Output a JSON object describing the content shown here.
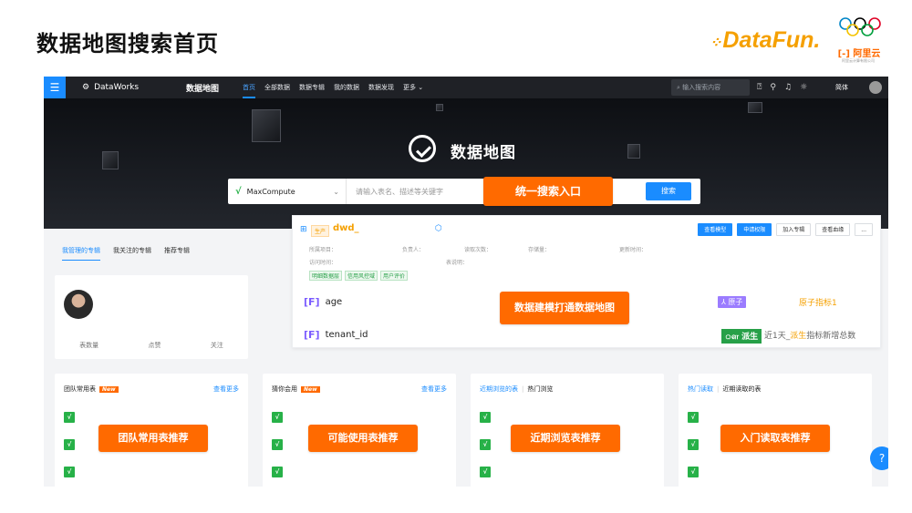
{
  "slide": {
    "title": "数据地图搜索首页"
  },
  "logos": {
    "datafun": "DataFun.",
    "aliyun": "阿里云",
    "aliyun_sub": "阿里云计算有限公司"
  },
  "colors": {
    "accent": "#1a8cff",
    "callout": "#ff6a00",
    "topbar": "#1f2126",
    "green": "#27b148"
  },
  "topbar": {
    "brand": "DataWorks",
    "product": "数据地图",
    "nav": [
      "首页",
      "全部数据",
      "数据专辑",
      "我的数据",
      "数据发现",
      "更多 ⌄"
    ],
    "search_placeholder": "输入搜索内容",
    "lang": "简体",
    "icons": [
      "help-icon",
      "wrench-icon",
      "bell-icon",
      "bug-icon"
    ]
  },
  "hero": {
    "title": "数据地图",
    "engine": "MaxCompute",
    "placeholder": "请输入表名、描述等关键字",
    "search_button": "搜索",
    "callout": "统一搜索入口"
  },
  "tabs": [
    "我管理的专辑",
    "我关注的专辑",
    "推荐专辑"
  ],
  "profile": {
    "stats": [
      "表数量",
      "点赞",
      "关注"
    ]
  },
  "result": {
    "env": "生产",
    "name": "dwd_",
    "buttons": [
      "查看模型",
      "申请权限",
      "加入专辑",
      "查看血缘",
      "..."
    ],
    "meta_row1": [
      "所属项目：",
      "负责人：",
      "读取次数：",
      "存储量：",
      "更新时间："
    ],
    "meta_row2": [
      "访问时间：",
      "表说明："
    ],
    "tags": [
      "明细数据层",
      "信用风控域",
      "用户评价"
    ],
    "fields": [
      {
        "icon": "[F]",
        "name": "age"
      },
      {
        "icon": "[F]",
        "name": "tenant_id"
      }
    ],
    "atom_badge": "⅄ 原子",
    "atom_text": "原子指标1",
    "derive_badge": "ௗ 派生",
    "derive_text_pre": "近1天_",
    "derive_text_hl": "派生",
    "derive_text_post": "指标新增总数",
    "callout": "数据建模打通数据地图"
  },
  "panels": [
    {
      "title": "团队常用表",
      "badge": "New",
      "more": "查看更多",
      "callout": "团队常用表推荐"
    },
    {
      "title": "猜你会用",
      "badge": "New",
      "more": "查看更多",
      "callout": "可能使用表推荐"
    },
    {
      "title_a": "近期浏览的表",
      "title_b": "热门浏览",
      "callout": "近期浏览表推荐"
    },
    {
      "title_a": "热门读取",
      "title_b": "近期读取的表",
      "callout": "入门读取表推荐"
    }
  ]
}
